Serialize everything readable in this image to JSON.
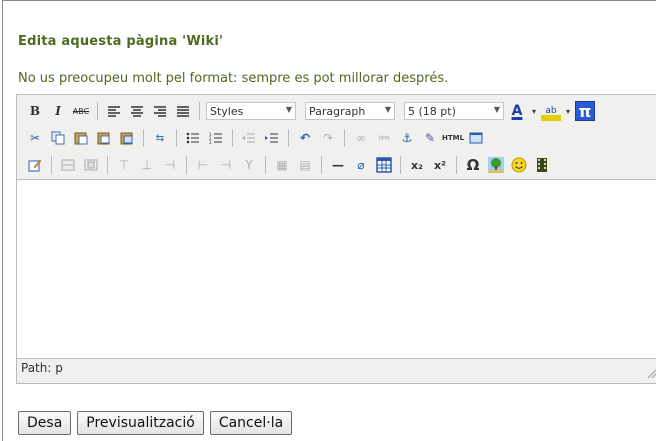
{
  "page": {
    "title": "Edita aquesta pàgina 'Wiki'",
    "hint": "No us preocupeu molt pel format: sempre es pot millorar després."
  },
  "editor": {
    "styles_select": "Styles",
    "format_select": "Paragraph",
    "fontsize_select": "5 (18 pt)",
    "path_text": "Path: p"
  },
  "buttons": {
    "save": "Desa",
    "preview": "Previsualització",
    "cancel": "Cancel·la"
  },
  "icons": {
    "bold_glyph": "B",
    "italic_glyph": "I",
    "strike_glyph": "ABC",
    "pi_glyph": "π",
    "sub_glyph": "x₂",
    "sup_glyph": "x²",
    "omega_glyph": "Ω",
    "html_glyph": "HTML"
  }
}
